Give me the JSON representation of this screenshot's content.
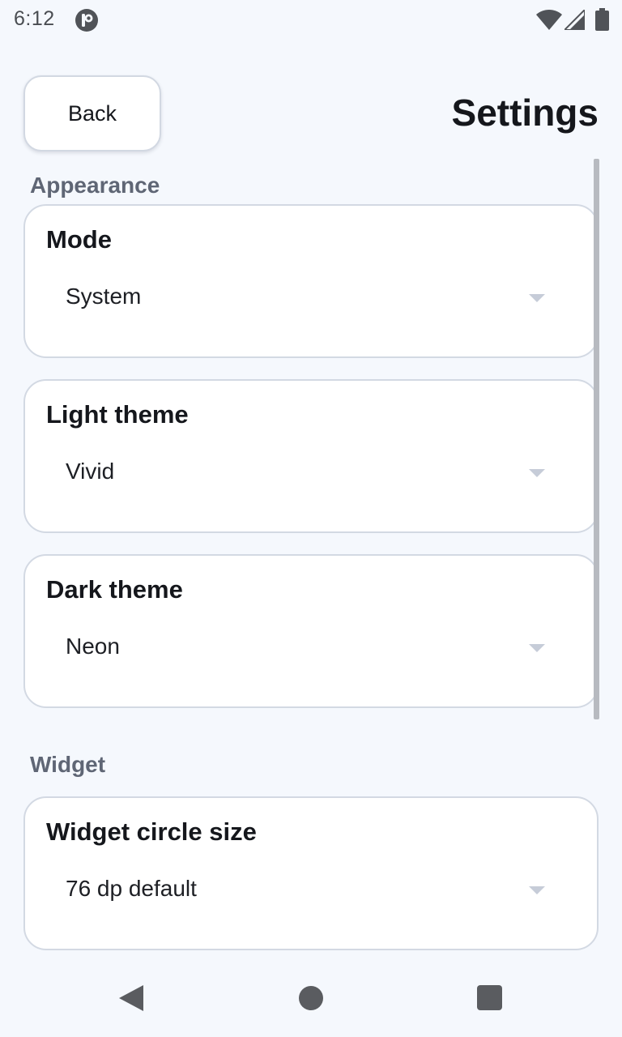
{
  "status_bar": {
    "time": "6:12",
    "icons": [
      "app-notification-icon",
      "wifi-icon",
      "signal-icon",
      "battery-icon"
    ]
  },
  "header": {
    "back_label": "Back",
    "title": "Settings"
  },
  "sections": {
    "appearance": {
      "label": "Appearance",
      "mode": {
        "title": "Mode",
        "value": "System"
      },
      "light_theme": {
        "title": "Light theme",
        "value": "Vivid"
      },
      "dark_theme": {
        "title": "Dark theme",
        "value": "Neon"
      }
    },
    "widget": {
      "label": "Widget",
      "circle_size": {
        "title": "Widget circle size",
        "value": "76 dp default"
      }
    }
  },
  "nav_bar": {
    "icons": [
      "nav-back-icon",
      "nav-home-icon",
      "nav-recents-icon"
    ]
  },
  "colors": {
    "background": "#f5f8fd",
    "card": "#ffffff",
    "card_border": "#d3d9e3",
    "section_header": "#5f6675",
    "text": "#15171c"
  }
}
